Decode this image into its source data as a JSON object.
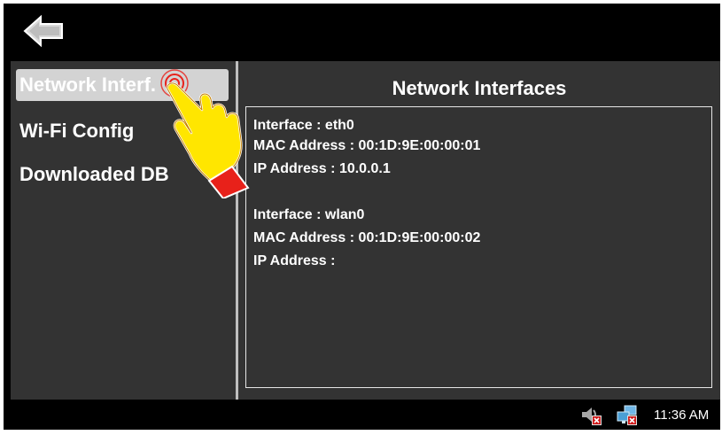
{
  "toolbar": {
    "back_icon": "back-arrow-icon"
  },
  "sidebar": {
    "items": [
      {
        "label": "Network Interf.",
        "selected": true
      },
      {
        "label": "Wi-Fi Config",
        "selected": false
      },
      {
        "label": "Downloaded DB",
        "selected": false
      }
    ]
  },
  "main": {
    "title": "Network Interfaces",
    "interfaces": [
      {
        "interface_label": "Interface :",
        "interface_value": "eth0",
        "mac_label": "MAC Address :",
        "mac_value": "00:1D:9E:00:00:01",
        "ip_label": "IP Address  :",
        "ip_value": "10.0.0.1"
      },
      {
        "interface_label": "Interface :",
        "interface_value": "wlan0",
        "mac_label": "MAC Address :",
        "mac_value": "00:1D:9E:00:00:02",
        "ip_label": "IP Address  :",
        "ip_value": ""
      }
    ]
  },
  "taskbar": {
    "icons": [
      "volume-muted-icon",
      "network-disconnected-icon"
    ],
    "clock": "11:36 AM"
  },
  "colors": {
    "background": "#000000",
    "panel": "#333333",
    "selected_item": "#d3d3d3",
    "text": "#ffffff",
    "hand_fill": "#ffe600",
    "hand_cuff": "#e8211a"
  }
}
